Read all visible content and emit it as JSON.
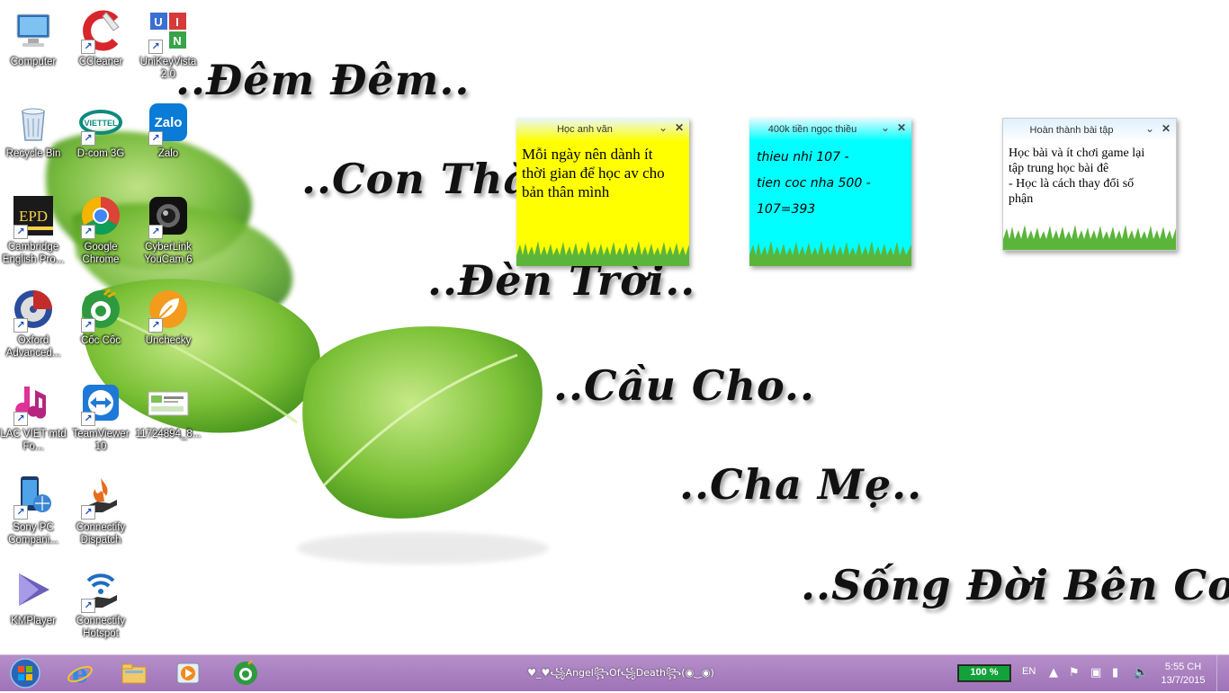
{
  "wallpaper": {
    "poem": [
      "..Đêm Đêm..",
      "..Con Thắp..",
      "..Đèn Trời..",
      "..Cầu Cho..",
      "..Cha Mẹ..",
      "..Sống Đời Bên Con.."
    ]
  },
  "desktop_icons": [
    {
      "label": "Computer",
      "icon": "computer-icon"
    },
    {
      "label": "CCleaner",
      "icon": "ccleaner-icon"
    },
    {
      "label": "UniKeyVista 2.0",
      "icon": "unikey-icon"
    },
    {
      "label": "Recycle Bin",
      "icon": "recycle-bin-icon"
    },
    {
      "label": "D-com 3G",
      "icon": "viettel-icon"
    },
    {
      "label": "Zalo",
      "icon": "zalo-icon"
    },
    {
      "label": "Cambridge English Pro...",
      "icon": "epd-icon"
    },
    {
      "label": "Google Chrome",
      "icon": "chrome-icon"
    },
    {
      "label": "CyberLink YouCam 6",
      "icon": "youcam-icon"
    },
    {
      "label": "Oxford Advanced...",
      "icon": "oxford-icon"
    },
    {
      "label": "Cốc Cốc",
      "icon": "coccoc-icon"
    },
    {
      "label": "Unchecky",
      "icon": "unchecky-icon"
    },
    {
      "label": "LAC VIET mtd Fo...",
      "icon": "lacviet-icon"
    },
    {
      "label": "TeamViewer 10",
      "icon": "teamviewer-icon"
    },
    {
      "label": "11724894_8...",
      "icon": "image-file-icon"
    },
    {
      "label": "Sony PC Compani...",
      "icon": "sony-icon"
    },
    {
      "label": "Connectify Dispatch",
      "icon": "connectify-dispatch-icon"
    },
    {
      "label": "KMPlayer",
      "icon": "kmplayer-icon"
    },
    {
      "label": "Connectify Hotspot",
      "icon": "connectify-hotspot-icon"
    }
  ],
  "notes": [
    {
      "title": "Học anh văn",
      "lines": [
        "Mỗi ngày nên dành ít",
        "thời gian để học av cho",
        "bản thân mình"
      ],
      "color": "#ffff00"
    },
    {
      "title": "400k tiền ngọc thiều",
      "lines": [
        "thieu nhi  107 -",
        "tien coc nha 500 -",
        "107=393"
      ],
      "color": "#00ffff"
    },
    {
      "title": "Hoàn thành bài tập",
      "lines": [
        "Học bài và ít chơi game lại",
        "tập trung học bài đê",
        "- Học  là  cách thay đổi số",
        "phận"
      ],
      "color": "#ffffff"
    }
  ],
  "taskbar": {
    "window_title": "♥_♥꧁Angel꧂Of꧁Death꧂(◉‿◉)",
    "battery": {
      "label": "100 %",
      "level": 1.0
    },
    "language": "EN",
    "clock": {
      "time": "5:55 CH",
      "date": "13/7/2015"
    },
    "pinned": [
      "start-orb-icon",
      "internet-explorer-icon",
      "file-explorer-icon",
      "media-player-icon",
      "coccoc-icon"
    ]
  }
}
